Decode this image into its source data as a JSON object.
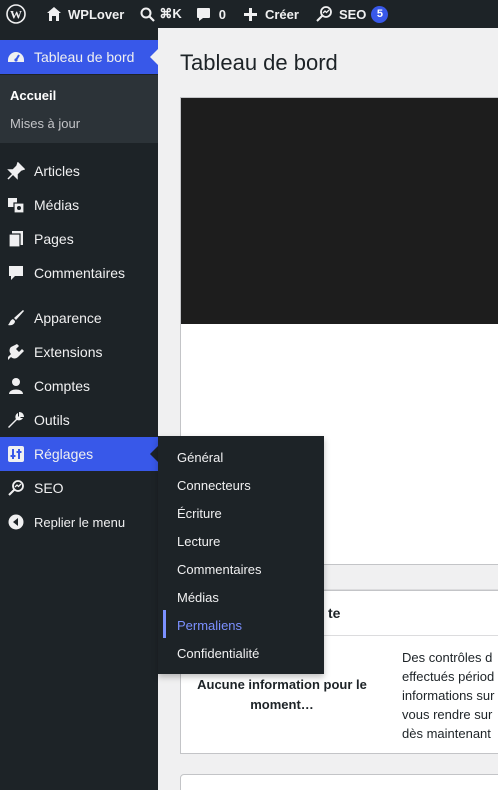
{
  "admin_bar": {
    "site_name": "WPLover",
    "search_shortcut": "⌘K",
    "comments_count": "0",
    "create_label": "Créer",
    "seo_label": "SEO",
    "seo_badge": "5"
  },
  "sidebar": {
    "dashboard_label": "Tableau de bord",
    "dashboard_sub": [
      "Accueil",
      "Mises à jour"
    ],
    "items": [
      {
        "label": "Articles",
        "icon": "pin-icon"
      },
      {
        "label": "Médias",
        "icon": "media-icon"
      },
      {
        "label": "Pages",
        "icon": "pages-icon"
      },
      {
        "label": "Commentaires",
        "icon": "comment-icon"
      },
      {
        "label": "Apparence",
        "icon": "brush-icon"
      },
      {
        "label": "Extensions",
        "icon": "plugin-icon"
      },
      {
        "label": "Comptes",
        "icon": "user-icon"
      },
      {
        "label": "Outils",
        "icon": "wrench-icon"
      },
      {
        "label": "Réglages",
        "icon": "settings-icon"
      },
      {
        "label": "SEO",
        "icon": "seo-icon"
      },
      {
        "label": "Replier le menu",
        "icon": "collapse-icon"
      }
    ]
  },
  "flyout": {
    "items": [
      "Général",
      "Connecteurs",
      "Écriture",
      "Lecture",
      "Commentaires",
      "Médias",
      "Permaliens",
      "Confidentialité"
    ],
    "active": "Permaliens"
  },
  "main": {
    "title": "Tableau de bord",
    "site_health": {
      "title_fragment": "te",
      "empty_line1": "Aucune information pour le",
      "empty_line2": "moment…",
      "desc_lines": [
        "Des contrôles d",
        "effectués périod",
        "informations sur",
        "vous rendre sur",
        "dès maintenant"
      ]
    }
  },
  "colors": {
    "admin_bg": "#1d2327",
    "accent": "#3858e9",
    "flyout_active": "#7b90ff",
    "page_bg": "#f0f0f1"
  }
}
